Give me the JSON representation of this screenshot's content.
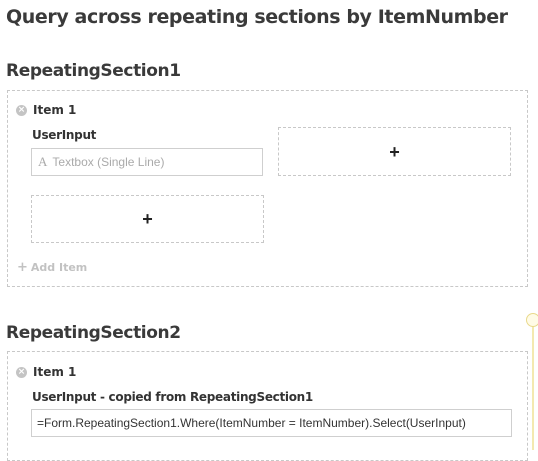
{
  "page": {
    "title": "Query across repeating sections by ItemNumber"
  },
  "section1": {
    "title": "RepeatingSection1",
    "item_label": "Item 1",
    "field_label": "UserInput",
    "textbox_icon": "A",
    "textbox_placeholder": "Textbox (Single Line)",
    "plus_symbol": "+",
    "add_item_label": "Add Item"
  },
  "section2": {
    "title": "RepeatingSection2",
    "item_label": "Item 1",
    "field_label": "UserInput - copied from RepeatingSection1",
    "formula": "=Form.RepeatingSection1.Where(ItemNumber = ItemNumber).Select(UserInput)"
  },
  "icons": {
    "remove": "remove-circle-icon",
    "plus": "plus-icon",
    "text": "text-field-icon"
  },
  "colors": {
    "accent_scroll": "#f3e9b0",
    "dashed_border": "#c8c8c8",
    "muted_text": "#c2c2c2"
  }
}
